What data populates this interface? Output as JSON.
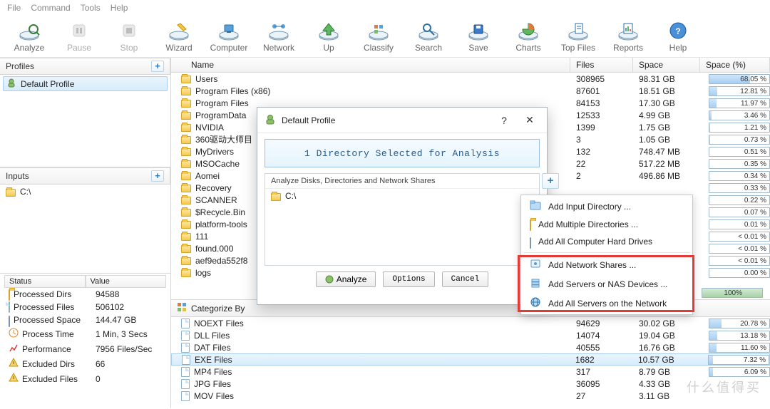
{
  "menu": [
    "File",
    "Command",
    "Tools",
    "Help"
  ],
  "toolbar": [
    {
      "label": "Analyze",
      "icon": "analyze"
    },
    {
      "label": "Pause",
      "icon": "pause",
      "disabled": true
    },
    {
      "label": "Stop",
      "icon": "stop",
      "disabled": true
    },
    {
      "label": "Wizard",
      "icon": "wizard"
    },
    {
      "label": "Computer",
      "icon": "computer"
    },
    {
      "label": "Network",
      "icon": "network"
    },
    {
      "label": "Up",
      "icon": "up"
    },
    {
      "label": "Classify",
      "icon": "classify"
    },
    {
      "label": "Search",
      "icon": "search"
    },
    {
      "label": "Save",
      "icon": "save"
    },
    {
      "label": "Charts",
      "icon": "charts"
    },
    {
      "label": "Top Files",
      "icon": "topfiles"
    },
    {
      "label": "Reports",
      "icon": "reports"
    },
    {
      "label": "Help",
      "icon": "help"
    }
  ],
  "panels": {
    "profiles": "Profiles",
    "inputs": "Inputs"
  },
  "profile_selected": "Default Profile",
  "input_drive": "C:\\",
  "status": {
    "hdr": [
      "Status",
      "Value"
    ],
    "rows": [
      {
        "icon": "folder",
        "k": "Processed Dirs",
        "v": "94588"
      },
      {
        "icon": "file",
        "k": "Processed Files",
        "v": "506102"
      },
      {
        "icon": "hdd",
        "k": "Processed Space",
        "v": "144.47 GB"
      },
      {
        "icon": "clock",
        "k": "Process Time",
        "v": "1 Min, 3 Secs"
      },
      {
        "icon": "perf",
        "k": "Performance",
        "v": "7956 Files/Sec"
      },
      {
        "icon": "excl",
        "k": "Excluded Dirs",
        "v": "66"
      },
      {
        "icon": "excl",
        "k": "Excluded Files",
        "v": "0"
      }
    ]
  },
  "grid": {
    "cols": [
      "Name",
      "Files",
      "Space",
      "Space (%)"
    ],
    "rows": [
      {
        "name": "Users",
        "files": "308965",
        "space": "98.31 GB",
        "pct": 68.05
      },
      {
        "name": "Program Files (x86)",
        "files": "87601",
        "space": "18.51 GB",
        "pct": 12.81
      },
      {
        "name": "Program Files",
        "files": "84153",
        "space": "17.30 GB",
        "pct": 11.97
      },
      {
        "name": "ProgramData",
        "files": "12533",
        "space": "4.99 GB",
        "pct": 3.46
      },
      {
        "name": "NVIDIA",
        "files": "1399",
        "space": "1.75 GB",
        "pct": 1.21
      },
      {
        "name": "360驱动大师目",
        "files": "3",
        "space": "1.05 GB",
        "pct": 0.73
      },
      {
        "name": "MyDrivers",
        "files": "132",
        "space": "748.47 MB",
        "pct": 0.51
      },
      {
        "name": "MSOCache",
        "files": "22",
        "space": "517.22 MB",
        "pct": 0.35
      },
      {
        "name": "Aomei",
        "files": "2",
        "space": "496.86 MB",
        "pct": 0.34
      },
      {
        "name": "Recovery",
        "files": "",
        "space": "",
        "pct": 0.33
      },
      {
        "name": "SCANNER",
        "files": "",
        "space": "",
        "pct": 0.22
      },
      {
        "name": "$Recycle.Bin",
        "files": "",
        "space": "",
        "pct": 0.07
      },
      {
        "name": "platform-tools",
        "files": "",
        "space": "",
        "pct": 0.01
      },
      {
        "name": "111",
        "files": "",
        "space": "",
        "pct": 0.01,
        "lt": true
      },
      {
        "name": "found.000",
        "files": "",
        "space": "",
        "pct": 0.01,
        "lt": true
      },
      {
        "name": "aef9eda552f8",
        "files": "",
        "space": "",
        "pct": 0.01,
        "lt": true
      },
      {
        "name": "logs",
        "files": "",
        "space": "",
        "pct": 0.0
      }
    ],
    "total_pct": "100%"
  },
  "categorize_label": "Categorize By",
  "catgrid": {
    "rows": [
      {
        "name": "NOEXT Files",
        "files": "94629",
        "space": "30.02 GB",
        "pct": 20.78
      },
      {
        "name": "DLL Files",
        "files": "14074",
        "space": "19.04 GB",
        "pct": 13.18
      },
      {
        "name": "DAT Files",
        "files": "40555",
        "space": "16.76 GB",
        "pct": 11.6
      },
      {
        "name": "EXE Files",
        "files": "1682",
        "space": "10.57 GB",
        "pct": 7.32,
        "sel": true
      },
      {
        "name": "MP4 Files",
        "files": "317",
        "space": "8.79 GB",
        "pct": 6.09
      },
      {
        "name": "JPG Files",
        "files": "36095",
        "space": "4.33 GB",
        "pct": ""
      },
      {
        "name": "MOV Files",
        "files": "27",
        "space": "3.11 GB",
        "pct": ""
      }
    ]
  },
  "modal": {
    "title": "Default Profile",
    "banner": "1 Directory Selected for Analysis",
    "list_hdr": "Analyze Disks, Directories and Network Shares",
    "item": "C:\\",
    "btn_analyze": "Analyze",
    "btn_options": "Options",
    "btn_cancel": "Cancel"
  },
  "ddmenu": [
    {
      "icon": "folder-blue",
      "label": "Add Input Directory ..."
    },
    {
      "icon": "folder",
      "label": "Add Multiple Directories ..."
    },
    {
      "icon": "hdd",
      "label": "Add All Computer Hard Drives"
    },
    {
      "sep": true
    },
    {
      "icon": "netshare",
      "label": "Add Network Shares ..."
    },
    {
      "icon": "server",
      "label": "Add Servers or NAS Devices ..."
    },
    {
      "icon": "globe",
      "label": "Add All Servers on the Network"
    }
  ],
  "watermark": "什么值得买"
}
